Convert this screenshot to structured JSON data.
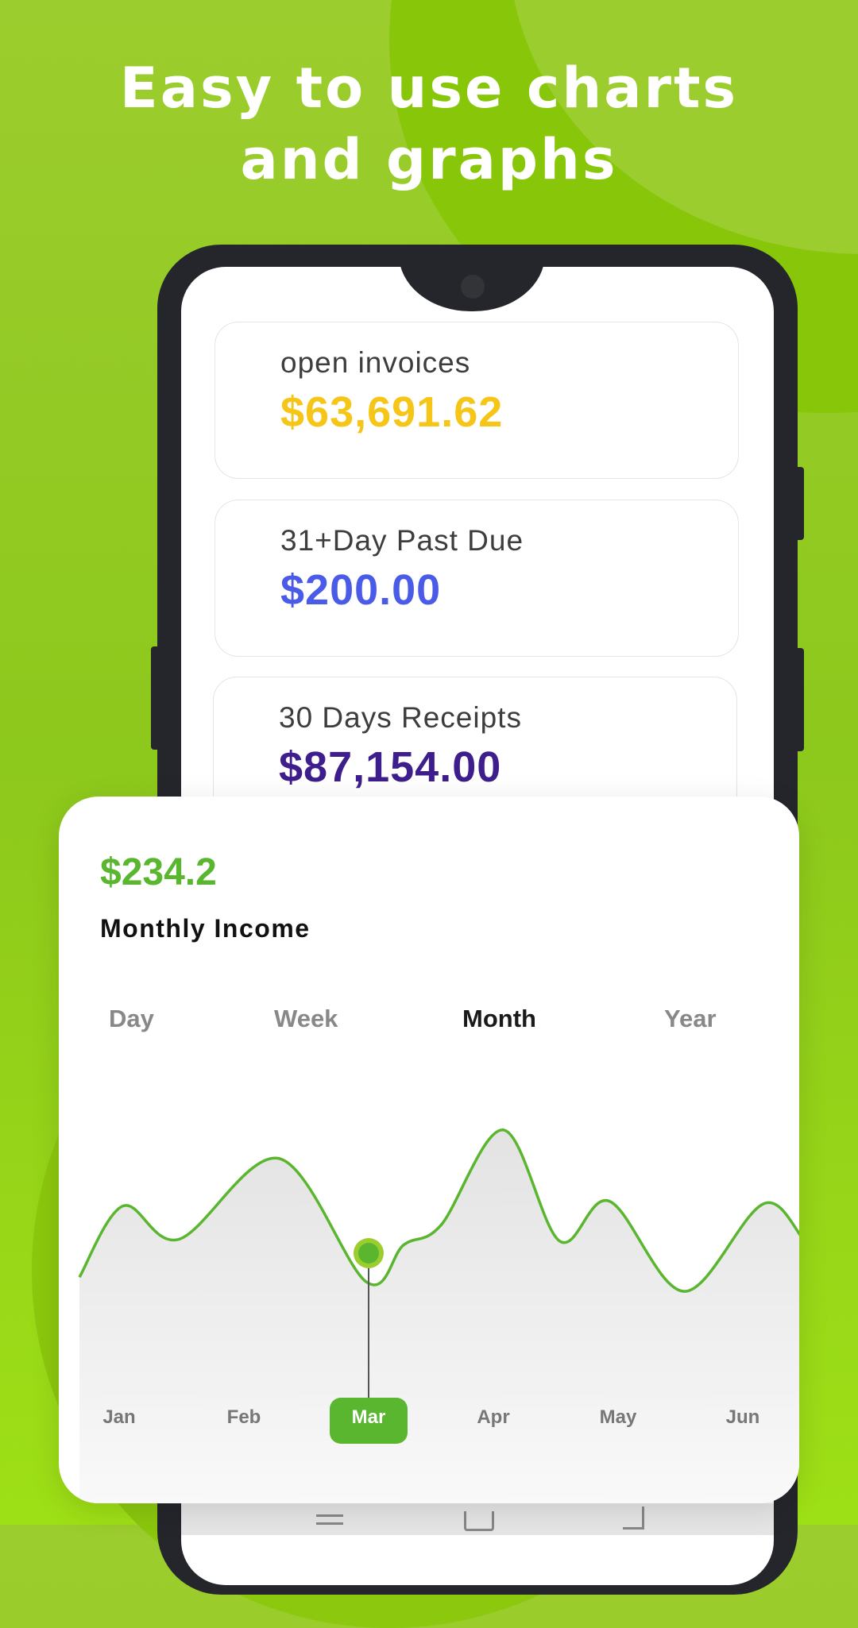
{
  "headline": [
    "Easy to use charts",
    "and graphs"
  ],
  "cards": [
    {
      "label": "open invoices",
      "value": "$63,691.62",
      "color": "#f5c518"
    },
    {
      "label": "31+Day Past Due",
      "value": "$200.00",
      "color": "#4a5be8"
    },
    {
      "label": "30 Days Receipts",
      "value": "$87,154.00",
      "color": "#3d1e8c"
    }
  ],
  "income": {
    "amount": "$234.2",
    "title": "Monthly Income",
    "accent": "#5ab52f"
  },
  "tabs": [
    {
      "label": "Day",
      "active": false
    },
    {
      "label": "Week",
      "active": false
    },
    {
      "label": "Month",
      "active": true
    },
    {
      "label": "Year",
      "active": false
    }
  ],
  "nav_icons": [
    "menu-icon",
    "home-icon",
    "back-icon"
  ],
  "chart_data": {
    "type": "area",
    "title": "Monthly Income",
    "categories": [
      "Jan",
      "Feb",
      "Mar",
      "Apr",
      "May",
      "Jun"
    ],
    "selected": "Mar",
    "selected_value": 234.2,
    "series": [
      {
        "name": "Income",
        "color": "#5ab52f",
        "x": [
          0,
          0.35,
          0.8,
          1.6,
          2.3,
          2.6,
          2.9,
          3.4,
          3.85,
          4.25,
          4.85,
          5.5,
          5.95,
          6.4
        ],
        "values": [
          200,
          275,
          240,
          325,
          195,
          234,
          255,
          355,
          238,
          280,
          185,
          278,
          225,
          300
        ]
      }
    ],
    "ylim": [
      150,
      380
    ],
    "grid": false,
    "legend": "none"
  }
}
